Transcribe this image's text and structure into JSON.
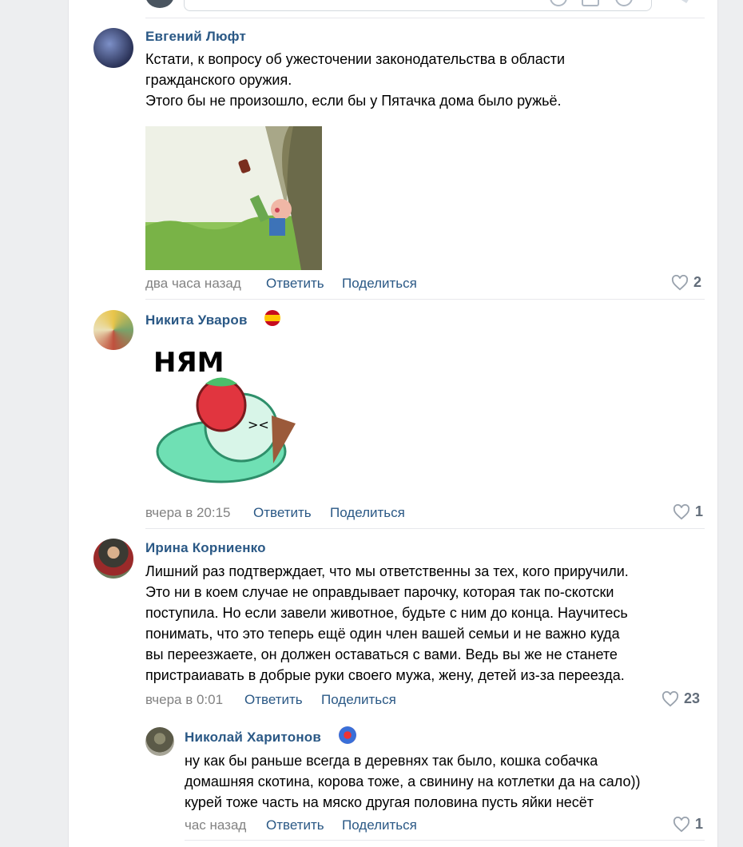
{
  "comments": [
    {
      "author": "Евгений Люфт",
      "text": "Кстати, к вопросу об ужесточении законодательства в области\nгражданского оружия.\nЭтого бы не произошло, если бы у Пятачка дома было ружьё.",
      "time": "два часа назад",
      "reply": "Ответить",
      "share": "Поделиться",
      "likes": "2"
    },
    {
      "author": "Никита Уваров",
      "sticker_text": "НЯМ",
      "time": "вчера в 20:15",
      "reply": "Ответить",
      "share": "Поделиться",
      "likes": "1"
    },
    {
      "author": "Ирина Корниенко",
      "text": "Лишний раз подтверждает, что мы ответственны за тех, кого приручили.\nЭто ни в коем случае не оправдывает парочку, которая так по-скотски\nпоступила. Но если завели животное, будьте с ним до конца. Научитесь\nпонимать, что это теперь ещё один член вашей семьи и не важно куда\nвы переезжаете, он должен оставаться с вами. Ведь вы же не станете\nпристраиавать в добрые руки своего мужа, жену, детей из-за переезда.",
      "time": "вчера в 0:01",
      "reply": "Ответить",
      "share": "Поделиться",
      "likes": "23"
    },
    {
      "author": "Николай Харитонов",
      "text": "ну как бы раньше всегда в деревнях так было, кошка собачка\nдомашняя скотина, корова тоже, а свинину на котлетки да на сало))\nкурей тоже часть на мяско другая половина пусть яйки несёт",
      "time": "час назад",
      "reply": "Ответить",
      "share": "Поделиться",
      "likes": "1"
    }
  ],
  "colors": {
    "link": "#2a5885",
    "meta": "#828282",
    "like": "#626d7a"
  },
  "icons": [
    "heart-icon",
    "flag-spain-icon",
    "captain-badge-icon"
  ]
}
